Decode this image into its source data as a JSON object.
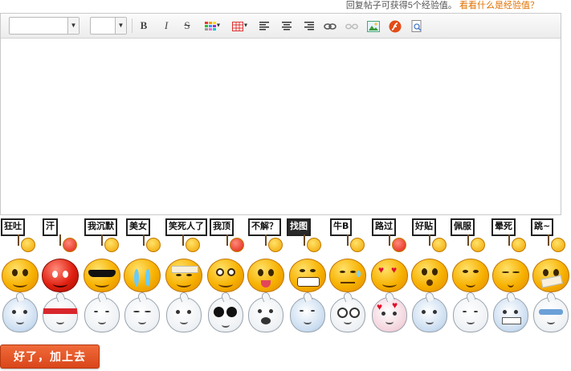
{
  "header": {
    "tip_text": "回复帖子可获得5个经验值。",
    "tip_link": "看看什么是经验值？"
  },
  "toolbar": {
    "font_select_value": "",
    "size_select_value": "",
    "buttons": [
      "bold",
      "italic",
      "strikethrough",
      "color-palette",
      "table",
      "align-left",
      "align-center",
      "align-right",
      "link",
      "unlink",
      "image",
      "flash",
      "preview"
    ],
    "bold_label": "B",
    "italic_label": "I",
    "strike_label": "S"
  },
  "editor": {
    "content": ""
  },
  "emoticons": {
    "sign_row": [
      "狂吐",
      "汗",
      "我沉默",
      "美女",
      "笑死人了",
      "我顶",
      "不解？",
      "找图",
      "牛B",
      "路过",
      "好贴",
      "佩服",
      "晕死",
      "跳~"
    ],
    "face_row": [
      "smile",
      "angry",
      "cool",
      "cry",
      "bandage",
      "dizzy",
      "tongue",
      "grin",
      "sweat",
      "love",
      "surprise",
      "shy",
      "sleepy",
      "sealed-lips"
    ],
    "onion_row": [
      "scream",
      "ninja",
      "sigh",
      "tired",
      "shock",
      "big-eyes",
      "crying",
      "frozen",
      "dizzy",
      "hearts",
      "tears",
      "think",
      "frightened",
      "sunglasses"
    ]
  },
  "submit": {
    "label": "好了，加上去"
  },
  "colors": {
    "link": "#e07000",
    "button": "#e05426",
    "border": "#c9c9c9"
  }
}
